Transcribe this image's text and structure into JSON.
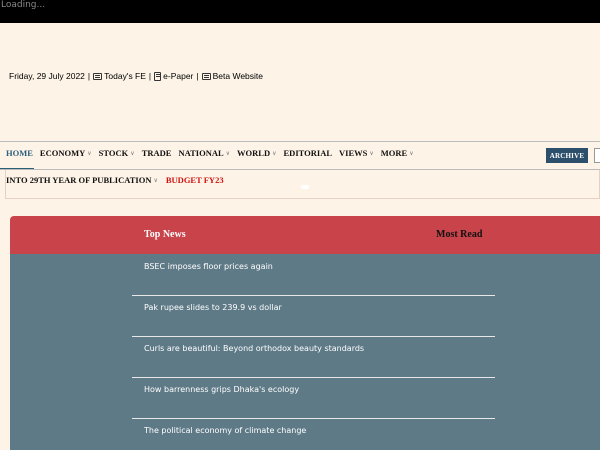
{
  "loading_text": "Loading...",
  "topbar": {
    "date": "Friday, 29 July 2022",
    "todays_fe": "Today's FE",
    "epaper": "e-Paper",
    "beta": "Beta Website",
    "separator": "|"
  },
  "nav": {
    "items": [
      {
        "label": "HOME",
        "dropdown": false
      },
      {
        "label": "ECONOMY",
        "dropdown": true
      },
      {
        "label": "STOCK",
        "dropdown": true
      },
      {
        "label": "TRADE",
        "dropdown": false
      },
      {
        "label": "NATIONAL",
        "dropdown": true
      },
      {
        "label": "WORLD",
        "dropdown": true
      },
      {
        "label": "EDITORIAL",
        "dropdown": false
      },
      {
        "label": "VIEWS",
        "dropdown": true
      },
      {
        "label": "MORE",
        "dropdown": true
      }
    ],
    "archive": "ARCHIVE"
  },
  "subnav": {
    "publication": "INTO 29TH YEAR OF PUBLICATION",
    "budget": "BUDGET FY23"
  },
  "panel": {
    "tab_top": "Top News",
    "tab_most": "Most Read",
    "news": [
      "BSEC imposes floor prices again",
      "Pak rupee slides to 239.9 vs dollar",
      "Curls are beautiful: Beyond orthodox beauty standards",
      "How barrenness grips Dhaka's ecology",
      "The political economy of climate change"
    ]
  },
  "colors": {
    "header_red": "#c8434a",
    "panel_slate": "#5e7a87",
    "archive_navy": "#2c4f6b",
    "budget_red": "#d01010",
    "page_bg": "#fdf3e7"
  }
}
